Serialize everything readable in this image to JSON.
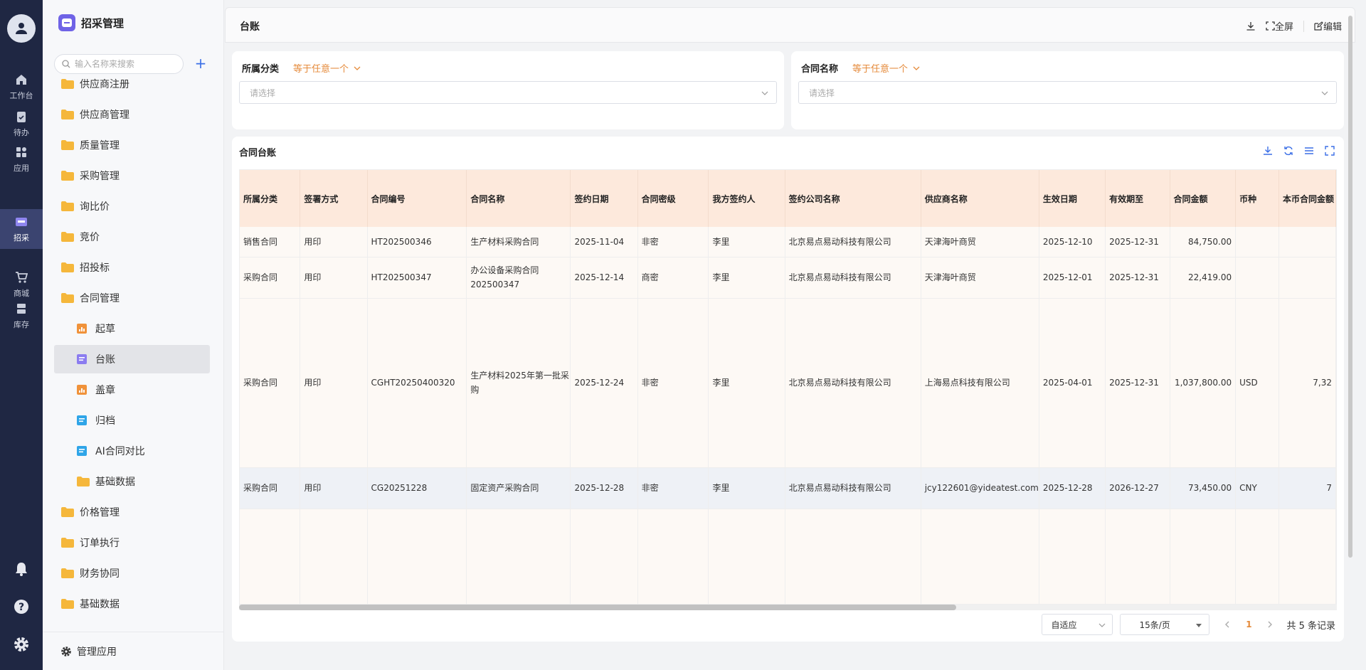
{
  "rail": {
    "items": [
      {
        "label": "工作台",
        "icon": "home-icon"
      },
      {
        "label": "待办",
        "icon": "clipboard-check-icon"
      },
      {
        "label": "应用",
        "icon": "apps-grid-icon"
      },
      {
        "label": "招采",
        "icon": "procurement-icon",
        "active": true
      },
      {
        "label": "商城",
        "icon": "cart-icon"
      },
      {
        "label": "库存",
        "icon": "inventory-icon"
      }
    ]
  },
  "sidebar": {
    "title": "招采管理",
    "search_placeholder": "输入名称来搜索",
    "add_symbol": "+",
    "items": [
      {
        "label": "供应商注册"
      },
      {
        "label": "供应商管理"
      },
      {
        "label": "质量管理"
      },
      {
        "label": "采购管理"
      },
      {
        "label": "询比价"
      },
      {
        "label": "竞价"
      },
      {
        "label": "招投标"
      },
      {
        "label": "合同管理"
      },
      {
        "label": "起草"
      },
      {
        "label": "台账"
      },
      {
        "label": "盖章"
      },
      {
        "label": "归档"
      },
      {
        "label": "AI合同对比"
      },
      {
        "label": "基础数据"
      },
      {
        "label": "价格管理"
      },
      {
        "label": "订单执行"
      },
      {
        "label": "财务协同"
      },
      {
        "label": "基础数据"
      }
    ],
    "footer_label": "管理应用"
  },
  "topbar": {
    "title": "台账",
    "fullscreen_label": "全屏",
    "edit_label": "编辑"
  },
  "filters": [
    {
      "label": "所属分类",
      "operator": "等于任意一个",
      "placeholder": "请选择"
    },
    {
      "label": "合同名称",
      "operator": "等于任意一个",
      "placeholder": "请选择"
    }
  ],
  "table": {
    "title": "合同台账",
    "columns": [
      "所属分类",
      "签署方式",
      "合同编号",
      "合同名称",
      "签约日期",
      "合同密级",
      "我方签约人",
      "签约公司名称",
      "供应商名称",
      "生效日期",
      "有效期至",
      "合同金额",
      "币种",
      "本币合同金额"
    ],
    "rows": [
      [
        "销售合同",
        "用印",
        "HT202500346",
        "生产材料采购合同",
        "2025-11-04",
        "非密",
        "李里",
        "北京易点易动科技有限公司",
        "天津海叶商贸",
        "2025-12-10",
        "2025-12-31",
        "84,750.00",
        "",
        ""
      ],
      [
        "采购合同",
        "用印",
        "HT202500347",
        "办公设备采购合同202500347",
        "2025-12-14",
        "商密",
        "李里",
        "北京易点易动科技有限公司",
        "天津海叶商贸",
        "2025-12-01",
        "2025-12-31",
        "22,419.00",
        "",
        ""
      ],
      [
        "采购合同",
        "用印",
        "CGHT20250400320",
        "生产材料2025年第一批采购",
        "2025-12-24",
        "非密",
        "李里",
        "北京易点易动科技有限公司",
        "上海易点科技有限公司",
        "2025-04-01",
        "2025-12-31",
        "1,037,800.00",
        "USD",
        "7,32"
      ],
      [
        "采购合同",
        "用印",
        "CG20251228",
        "固定资产采购合同",
        "2025-12-28",
        "非密",
        "李里",
        "北京易点易动科技有限公司",
        "jcy122601@yideatest.com",
        "2025-12-28",
        "2026-12-27",
        "73,450.00",
        "CNY",
        "7"
      ]
    ]
  },
  "pager": {
    "fit_label": "自适应",
    "page_size_label": "15条/页",
    "current_page": "1",
    "total_label": "共 5 条记录"
  },
  "colors": {
    "rail_bg": "#1f2743",
    "accent": "#e58a3a",
    "header_bg": "#fde9dc",
    "folder": "#f5b73b",
    "link_blue": "#3b6fe6"
  }
}
